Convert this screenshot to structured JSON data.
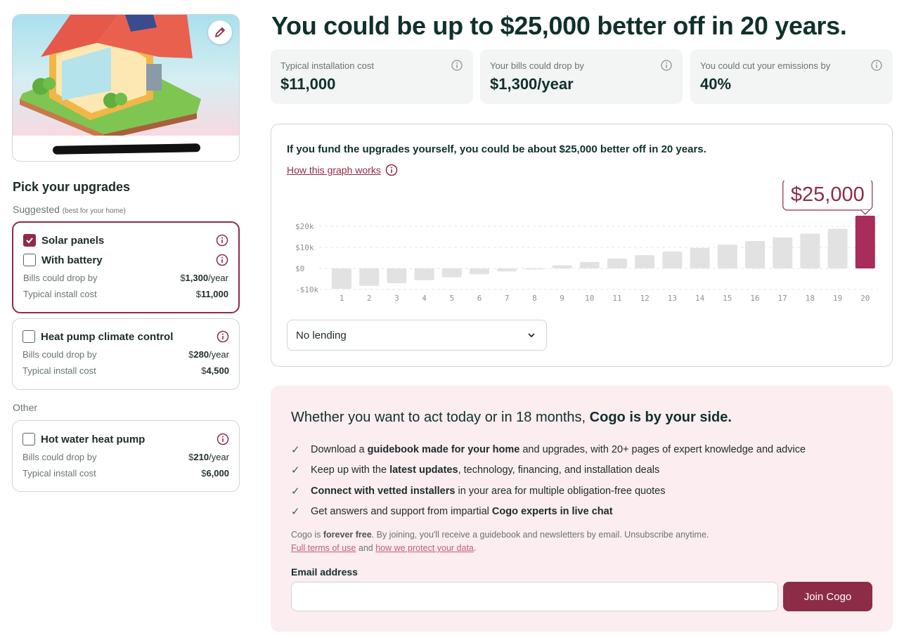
{
  "house": {
    "edit_icon": "pencil-icon",
    "address_redacted": true
  },
  "upgrades": {
    "title": "Pick your upgrades",
    "suggested_label": "Suggested",
    "suggested_note": "(best for your home)",
    "other_label": "Other",
    "bills_label": "Bills could drop by",
    "install_label": "Typical install cost",
    "suggested": [
      {
        "name": "Solar panels",
        "checked": true,
        "sub_option": {
          "name": "With battery",
          "checked": false
        },
        "bills_prefix": "$",
        "bills_value": "1,300",
        "bills_suffix": "/year",
        "install_prefix": "$",
        "install_value": "11,000"
      },
      {
        "name": "Heat pump climate control",
        "checked": false,
        "bills_prefix": "$",
        "bills_value": "280",
        "bills_suffix": "/year",
        "install_prefix": "$",
        "install_value": "4,500"
      }
    ],
    "other": [
      {
        "name": "Hot water heat pump",
        "checked": false,
        "bills_prefix": "$",
        "bills_value": "210",
        "bills_suffix": "/year",
        "install_prefix": "$",
        "install_value": "6,000"
      }
    ]
  },
  "headline": "You could be up to $25,000 better off in 20 years.",
  "kpis": [
    {
      "label": "Typical installation cost",
      "value": "$11,000"
    },
    {
      "label": "Your bills could drop by",
      "value": "$1,300/year"
    },
    {
      "label": "You could cut your emissions by",
      "value": "40%"
    }
  ],
  "graph": {
    "title": "If you fund the upgrades yourself, you could be about $25,000 better off in 20 years.",
    "link_label": "How this graph works",
    "callout": "$25,000",
    "lending_select": "No lending"
  },
  "chart_data": {
    "type": "bar",
    "categories": [
      "1",
      "2",
      "3",
      "4",
      "5",
      "6",
      "7",
      "8",
      "9",
      "10",
      "11",
      "12",
      "13",
      "14",
      "15",
      "16",
      "17",
      "18",
      "19",
      "20"
    ],
    "values": [
      -9700,
      -8300,
      -7000,
      -5600,
      -4200,
      -2800,
      -1400,
      -200,
      1500,
      3100,
      4700,
      6300,
      8000,
      9700,
      11300,
      13000,
      14700,
      16500,
      18800,
      25000
    ],
    "yticks": [
      "$20k",
      "$10k",
      "$0",
      "-$10k"
    ],
    "ytick_values": [
      20000,
      10000,
      0,
      -10000
    ],
    "ylim": [
      -10000,
      20000
    ],
    "highlight_index": 19,
    "colors": {
      "bar": "#e2e2e2",
      "highlight": "#a82d5b"
    }
  },
  "cta": {
    "title_plain": "Whether you want to act today or in 18 months, ",
    "title_bold": "Cogo is by your side.",
    "items": [
      {
        "parts": [
          {
            "t": "Download a ",
            "b": false
          },
          {
            "t": "guidebook made for your home",
            "b": true
          },
          {
            "t": " and upgrades, with 20+ pages of expert knowledge and advice",
            "b": false
          }
        ]
      },
      {
        "parts": [
          {
            "t": "Keep up with the ",
            "b": false
          },
          {
            "t": "latest updates",
            "b": true
          },
          {
            "t": ", technology, financing, and installation deals",
            "b": false
          }
        ]
      },
      {
        "parts": [
          {
            "t": "Connect with vetted installers",
            "b": true
          },
          {
            "t": " in your area for multiple obligation-free quotes",
            "b": false
          }
        ]
      },
      {
        "parts": [
          {
            "t": "Get answers and support from impartial ",
            "b": false
          },
          {
            "t": "Cogo experts in live chat",
            "b": true
          }
        ]
      }
    ],
    "fine_1": "Cogo is ",
    "fine_bold": "forever free",
    "fine_2": ". By joining, you'll receive a guidebook and newsletters by email. Unsubscribe anytime.",
    "terms_link": "Full terms of use",
    "and_text": " and ",
    "privacy_link": "how we protect your data",
    "period": ".",
    "email_label": "Email address",
    "email_value": "",
    "email_placeholder": "",
    "join_label": "Join Cogo"
  }
}
